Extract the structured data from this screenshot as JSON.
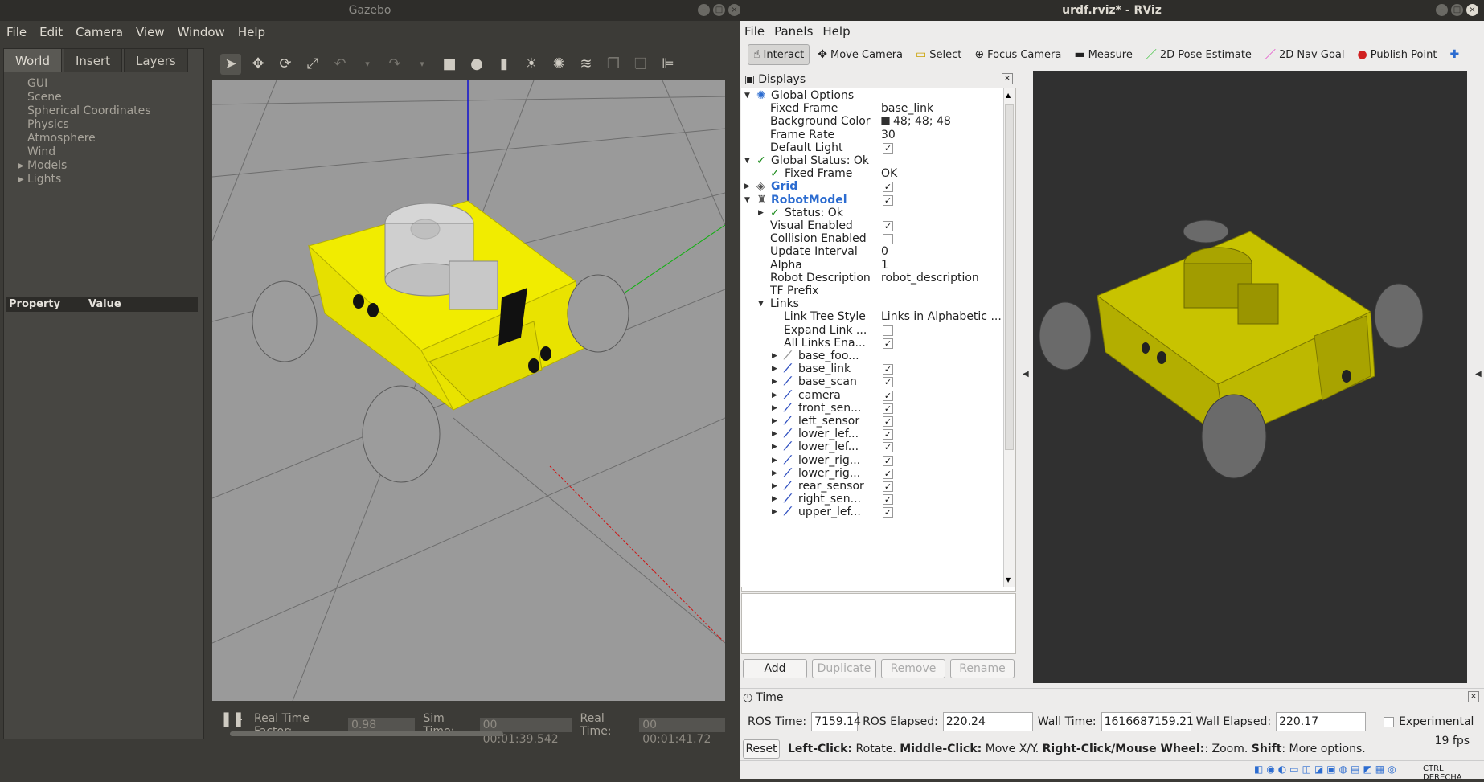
{
  "gazebo": {
    "title": "Gazebo",
    "menu": [
      "File",
      "Edit",
      "Camera",
      "View",
      "Window",
      "Help"
    ],
    "tabs": [
      "World",
      "Insert",
      "Layers"
    ],
    "world_tree": [
      "GUI",
      "Scene",
      "Spherical Coordinates",
      "Physics",
      "Atmosphere",
      "Wind",
      "Models",
      "Lights"
    ],
    "property_header": {
      "property": "Property",
      "value": "Value"
    },
    "status": {
      "rtf_label": "Real Time Factor:",
      "rtf_value": "0.98",
      "sim_label": "Sim Time:",
      "sim_value": "00 00:01:39.542",
      "real_label": "Real Time:",
      "real_value": "00 00:01:41.72"
    }
  },
  "rviz": {
    "title": "urdf.rviz* - RViz",
    "menu": [
      "File",
      "Panels",
      "Help"
    ],
    "toolbar": [
      "Interact",
      "Move Camera",
      "Select",
      "Focus Camera",
      "Measure",
      "2D Pose Estimate",
      "2D Nav Goal",
      "Publish Point"
    ],
    "displays_title": "Displays",
    "tree": [
      {
        "name": "Global Options",
        "value": "",
        "indent": 0,
        "arrow": "down",
        "icon": "globe",
        "check": null
      },
      {
        "name": "Fixed Frame",
        "value": "base_link",
        "indent": 1,
        "arrow": "",
        "icon": "",
        "check": null
      },
      {
        "name": "Background Color",
        "value": "48; 48; 48",
        "indent": 1,
        "arrow": "",
        "icon": "",
        "check": null,
        "swatch": "#303030"
      },
      {
        "name": "Frame Rate",
        "value": "30",
        "indent": 1,
        "arrow": "",
        "icon": "",
        "check": null
      },
      {
        "name": "Default Light",
        "value": "",
        "indent": 1,
        "arrow": "",
        "icon": "",
        "check": true
      },
      {
        "name": "Global Status: Ok",
        "value": "",
        "indent": 0,
        "arrow": "down",
        "icon": "ok",
        "check": null
      },
      {
        "name": "Fixed Frame",
        "value": "OK",
        "indent": 1,
        "arrow": "",
        "icon": "ok",
        "check": null
      },
      {
        "name": "Grid",
        "value": "",
        "indent": 0,
        "arrow": "right",
        "icon": "grid",
        "check": true,
        "blue": true
      },
      {
        "name": "RobotModel",
        "value": "",
        "indent": 0,
        "arrow": "down",
        "icon": "robot",
        "check": true,
        "blue": true
      },
      {
        "name": "Status: Ok",
        "value": "",
        "indent": 1,
        "arrow": "right",
        "icon": "ok",
        "check": null
      },
      {
        "name": "Visual Enabled",
        "value": "",
        "indent": 1,
        "arrow": "",
        "icon": "",
        "check": true
      },
      {
        "name": "Collision Enabled",
        "value": "",
        "indent": 1,
        "arrow": "",
        "icon": "",
        "check": false
      },
      {
        "name": "Update Interval",
        "value": "0",
        "indent": 1,
        "arrow": "",
        "icon": "",
        "check": null
      },
      {
        "name": "Alpha",
        "value": "1",
        "indent": 1,
        "arrow": "",
        "icon": "",
        "check": null
      },
      {
        "name": "Robot Description",
        "value": "robot_description",
        "indent": 1,
        "arrow": "",
        "icon": "",
        "check": null
      },
      {
        "name": "TF Prefix",
        "value": "",
        "indent": 1,
        "arrow": "",
        "icon": "",
        "check": null
      },
      {
        "name": "Links",
        "value": "",
        "indent": 1,
        "arrow": "down",
        "icon": "",
        "check": null
      },
      {
        "name": "Link Tree Style",
        "value": "Links in Alphabetic ...",
        "indent": 2,
        "arrow": "",
        "icon": "",
        "check": null
      },
      {
        "name": "Expand Link ...",
        "value": "",
        "indent": 2,
        "arrow": "",
        "icon": "",
        "check": false
      },
      {
        "name": "All Links Ena...",
        "value": "",
        "indent": 2,
        "arrow": "",
        "icon": "",
        "check": true
      },
      {
        "name": "base_foo...",
        "value": "",
        "indent": 2,
        "arrow": "right",
        "icon": "link-grey",
        "check": null
      },
      {
        "name": "base_link",
        "value": "",
        "indent": 2,
        "arrow": "right",
        "icon": "link",
        "check": true
      },
      {
        "name": "base_scan",
        "value": "",
        "indent": 2,
        "arrow": "right",
        "icon": "link",
        "check": true
      },
      {
        "name": "camera",
        "value": "",
        "indent": 2,
        "arrow": "right",
        "icon": "link",
        "check": true
      },
      {
        "name": "front_sen...",
        "value": "",
        "indent": 2,
        "arrow": "right",
        "icon": "link",
        "check": true
      },
      {
        "name": "left_sensor",
        "value": "",
        "indent": 2,
        "arrow": "right",
        "icon": "link",
        "check": true
      },
      {
        "name": "lower_lef...",
        "value": "",
        "indent": 2,
        "arrow": "right",
        "icon": "link",
        "check": true
      },
      {
        "name": "lower_lef...",
        "value": "",
        "indent": 2,
        "arrow": "right",
        "icon": "link",
        "check": true
      },
      {
        "name": "lower_rig...",
        "value": "",
        "indent": 2,
        "arrow": "right",
        "icon": "link",
        "check": true
      },
      {
        "name": "lower_rig...",
        "value": "",
        "indent": 2,
        "arrow": "right",
        "icon": "link",
        "check": true
      },
      {
        "name": "rear_sensor",
        "value": "",
        "indent": 2,
        "arrow": "right",
        "icon": "link",
        "check": true
      },
      {
        "name": "right_sen...",
        "value": "",
        "indent": 2,
        "arrow": "right",
        "icon": "link",
        "check": true
      },
      {
        "name": "upper_lef...",
        "value": "",
        "indent": 2,
        "arrow": "right",
        "icon": "link",
        "check": true
      }
    ],
    "buttons": {
      "add": "Add",
      "duplicate": "Duplicate",
      "remove": "Remove",
      "rename": "Rename"
    },
    "time": {
      "title": "Time",
      "ros_time_label": "ROS Time:",
      "ros_time": "7159.14",
      "ros_elapsed_label": "ROS Elapsed:",
      "ros_elapsed": "220.24",
      "wall_time_label": "Wall Time:",
      "wall_time": "1616687159.21",
      "wall_elapsed_label": "Wall Elapsed:",
      "wall_elapsed": "220.17",
      "experimental": "Experimental"
    },
    "reset": "Reset",
    "help": {
      "left": "Left-Click:",
      "left_desc": " Rotate. ",
      "middle": "Middle-Click:",
      "middle_desc": " Move X/Y. ",
      "right": "Right-Click/Mouse Wheel:",
      "right_desc": ": Zoom. ",
      "shift": "Shift",
      "shift_desc": ": More options."
    },
    "fps": "19 fps",
    "tray_text": "CTRL DERECHA"
  }
}
